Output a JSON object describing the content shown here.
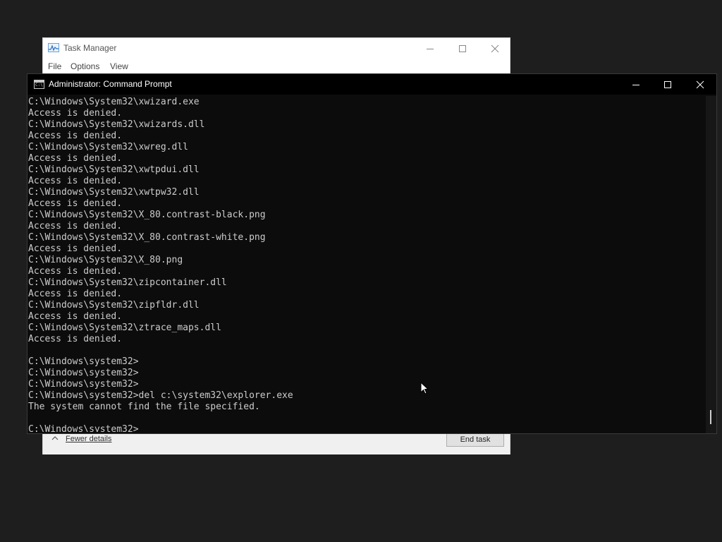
{
  "task_manager": {
    "title": "Task Manager",
    "menu": [
      "File",
      "Options",
      "View"
    ],
    "footer": {
      "fewer_details": "Fewer details",
      "end_task": "End task"
    }
  },
  "cmd": {
    "title": "Administrator: Command Prompt",
    "icon_text": "C:\\",
    "lines": [
      "C:\\Windows\\System32\\xwizard.exe",
      "Access is denied.",
      "C:\\Windows\\System32\\xwizards.dll",
      "Access is denied.",
      "C:\\Windows\\System32\\xwreg.dll",
      "Access is denied.",
      "C:\\Windows\\System32\\xwtpdui.dll",
      "Access is denied.",
      "C:\\Windows\\System32\\xwtpw32.dll",
      "Access is denied.",
      "C:\\Windows\\System32\\X_80.contrast-black.png",
      "Access is denied.",
      "C:\\Windows\\System32\\X_80.contrast-white.png",
      "Access is denied.",
      "C:\\Windows\\System32\\X_80.png",
      "Access is denied.",
      "C:\\Windows\\System32\\zipcontainer.dll",
      "Access is denied.",
      "C:\\Windows\\System32\\zipfldr.dll",
      "Access is denied.",
      "C:\\Windows\\System32\\ztrace_maps.dll",
      "Access is denied.",
      "",
      "C:\\Windows\\system32>",
      "C:\\Windows\\system32>",
      "C:\\Windows\\system32>",
      "C:\\Windows\\system32>del c:\\system32\\explorer.exe",
      "The system cannot find the file specified.",
      "",
      "C:\\Windows\\system32>"
    ]
  },
  "icons": {
    "task_manager_app": "task-manager-icon",
    "cmd_app": "command-prompt-icon",
    "minimize": "minimize-icon",
    "maximize": "maximize-icon",
    "close": "close-icon",
    "mouse": "mouse-pointer-icon"
  },
  "colors": {
    "console_bg": "#0c0c0c",
    "console_text": "#cccccc",
    "titlebar_bg": "#000000"
  }
}
